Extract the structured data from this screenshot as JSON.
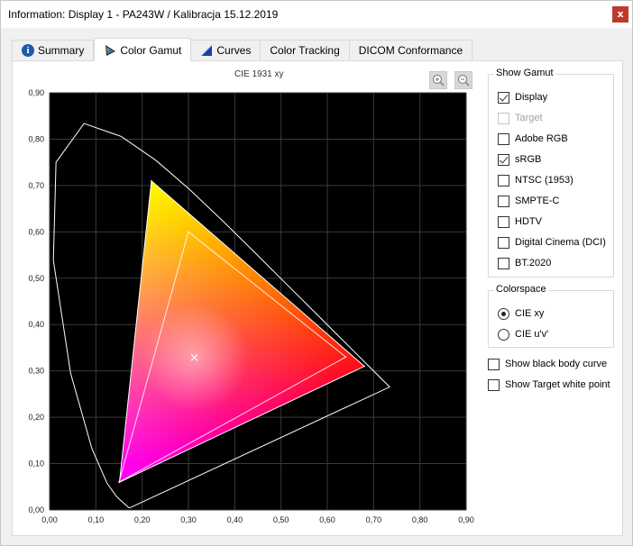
{
  "window": {
    "title": "Information: Display 1 - PA243W / Kalibracja 15.12.2019",
    "close_glyph": "x"
  },
  "tabs": [
    {
      "label": "Summary",
      "icon": "info-icon",
      "active": false
    },
    {
      "label": "Color Gamut",
      "icon": "color-gamut-icon",
      "active": true
    },
    {
      "label": "Curves",
      "icon": "curves-icon",
      "active": false
    },
    {
      "label": "Color Tracking",
      "icon": "",
      "active": false
    },
    {
      "label": "DICOM Conformance",
      "icon": "",
      "active": false
    }
  ],
  "chart": {
    "title": "CIE 1931 xy",
    "zoom_in_icon": "zoom-in-icon",
    "zoom_out_icon": "zoom-out-icon"
  },
  "show_gamut": {
    "title": "Show Gamut",
    "items": [
      {
        "label": "Display",
        "checked": true,
        "enabled": true
      },
      {
        "label": "Target",
        "checked": false,
        "enabled": false
      },
      {
        "label": "Adobe RGB",
        "checked": false,
        "enabled": true
      },
      {
        "label": "sRGB",
        "checked": true,
        "enabled": true
      },
      {
        "label": "NTSC (1953)",
        "checked": false,
        "enabled": true
      },
      {
        "label": "SMPTE-C",
        "checked": false,
        "enabled": true
      },
      {
        "label": "HDTV",
        "checked": false,
        "enabled": true
      },
      {
        "label": "Digital Cinema (DCI)",
        "checked": false,
        "enabled": true
      },
      {
        "label": "BT.2020",
        "checked": false,
        "enabled": true
      }
    ]
  },
  "colorspace": {
    "title": "Colorspace",
    "options": [
      {
        "label": "CIE xy",
        "selected": true
      },
      {
        "label": "CIE u'v'",
        "selected": false
      }
    ]
  },
  "options": {
    "black_body": {
      "label": "Show black body curve",
      "checked": false
    },
    "target_white": {
      "label": "Show Target white point",
      "checked": false
    }
  },
  "chart_data": {
    "type": "scatter",
    "title": "CIE 1931 xy",
    "xlim": [
      0,
      0.9
    ],
    "ylim": [
      0,
      0.9
    ],
    "grid": true,
    "x_ticks": [
      "0,00",
      "0,10",
      "0,20",
      "0,30",
      "0,40",
      "0,50",
      "0,60",
      "0,70",
      "0,80",
      "0,90"
    ],
    "y_ticks": [
      "0,00",
      "0,10",
      "0,20",
      "0,30",
      "0,40",
      "0,50",
      "0,60",
      "0,70",
      "0,80",
      "0,90"
    ],
    "background": "#000000",
    "spectral_locus": [
      [
        0.1741,
        0.005
      ],
      [
        0.1733,
        0.0048
      ],
      [
        0.1726,
        0.0048
      ],
      [
        0.1714,
        0.0051
      ],
      [
        0.1689,
        0.0069
      ],
      [
        0.1644,
        0.0109
      ],
      [
        0.1566,
        0.0177
      ],
      [
        0.144,
        0.0297
      ],
      [
        0.1241,
        0.0578
      ],
      [
        0.0913,
        0.1327
      ],
      [
        0.0454,
        0.295
      ],
      [
        0.0082,
        0.5384
      ],
      [
        0.0139,
        0.7502
      ],
      [
        0.0743,
        0.8338
      ],
      [
        0.1547,
        0.8059
      ],
      [
        0.2296,
        0.7543
      ],
      [
        0.3016,
        0.6923
      ],
      [
        0.3731,
        0.6245
      ],
      [
        0.4441,
        0.5547
      ],
      [
        0.5125,
        0.4866
      ],
      [
        0.5752,
        0.4242
      ],
      [
        0.627,
        0.3725
      ],
      [
        0.6658,
        0.334
      ],
      [
        0.6915,
        0.3083
      ],
      [
        0.7079,
        0.292
      ],
      [
        0.719,
        0.2809
      ],
      [
        0.726,
        0.274
      ],
      [
        0.7347,
        0.2653
      ]
    ],
    "series": [
      {
        "name": "Display",
        "points": [
          [
            0.68,
            0.31
          ],
          [
            0.22,
            0.71
          ],
          [
            0.151,
            0.06
          ]
        ],
        "color": "#ffffff"
      },
      {
        "name": "sRGB",
        "points": [
          [
            0.64,
            0.33
          ],
          [
            0.3,
            0.6
          ],
          [
            0.15,
            0.06
          ]
        ],
        "color": "#ffffff"
      }
    ],
    "white_point": {
      "x": 0.3127,
      "y": 0.329
    }
  }
}
